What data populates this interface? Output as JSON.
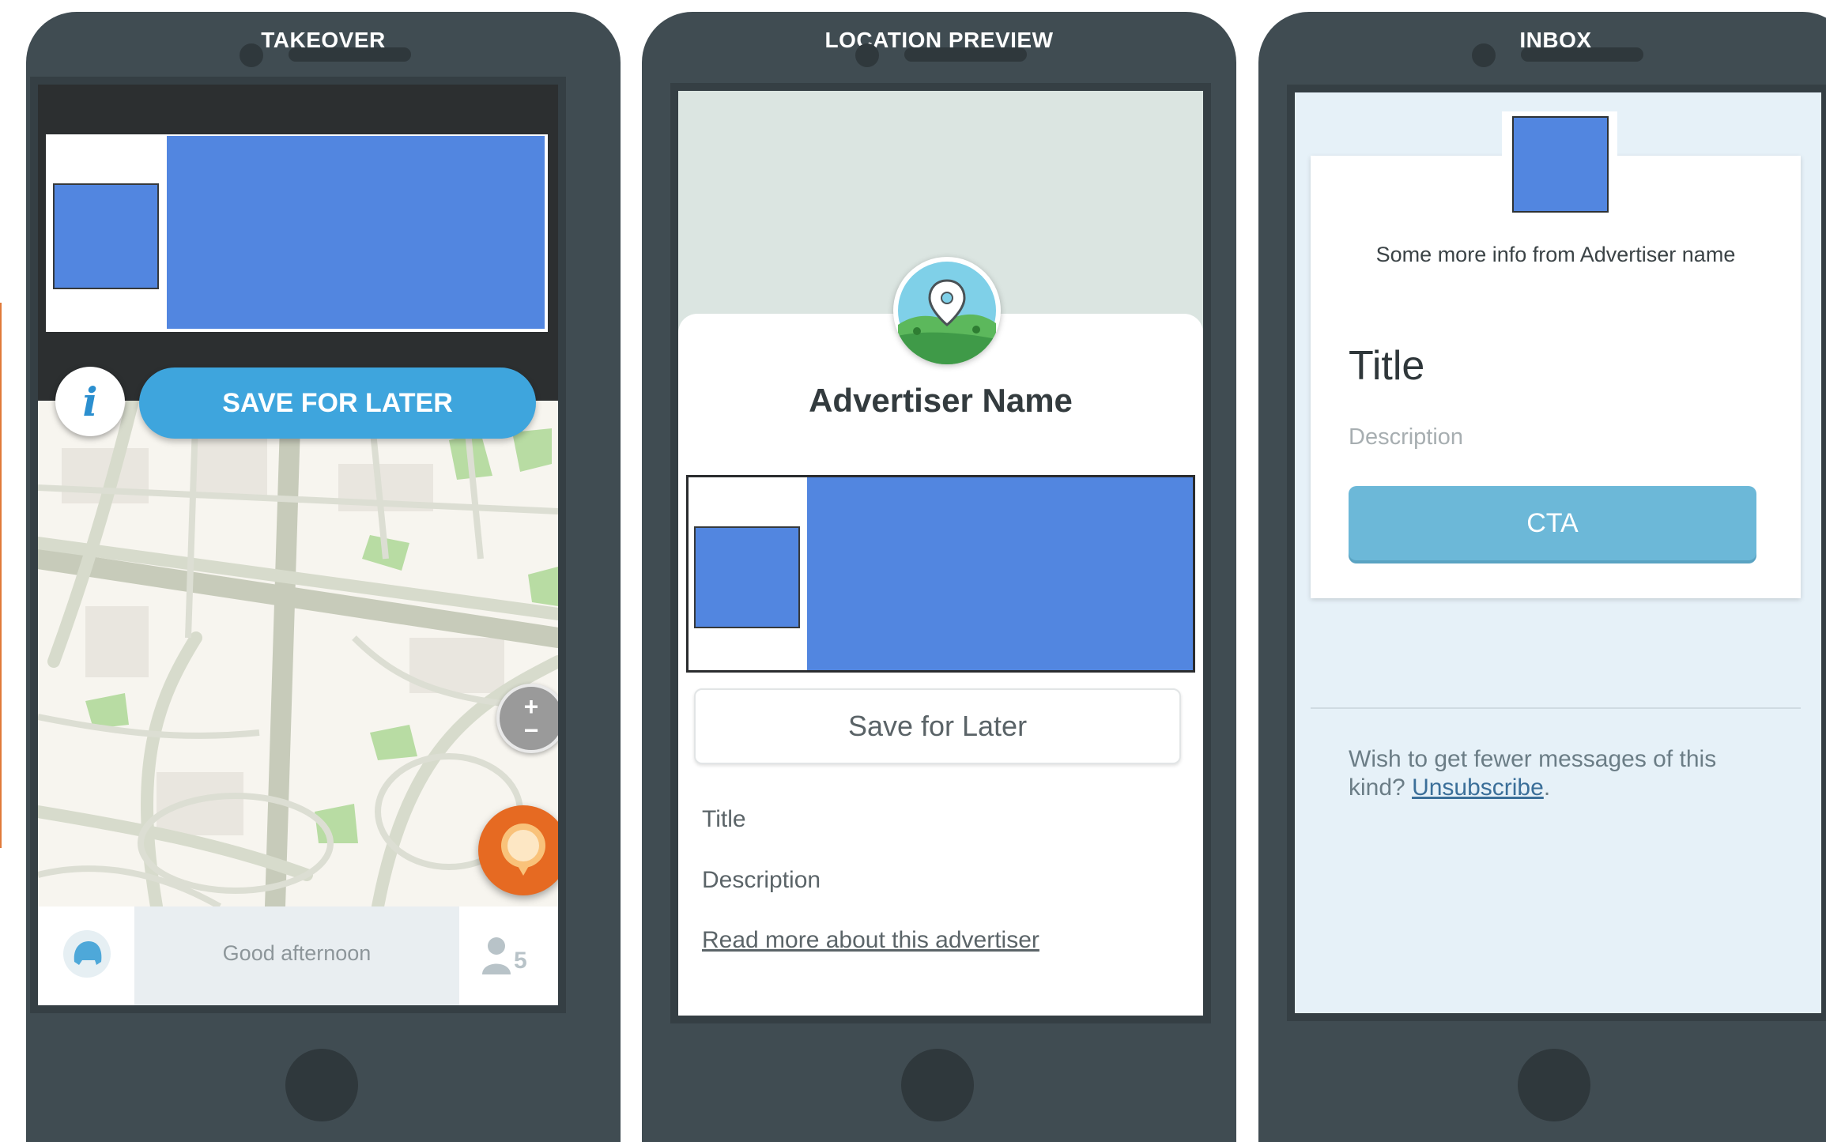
{
  "phones": [
    {
      "title": "TAKEOVER",
      "info_icon": "i",
      "save_button": "SAVE FOR LATER",
      "zoom_in": "+",
      "zoom_out": "−",
      "greeting": "Good afternoon",
      "friends_count": "5"
    },
    {
      "title": "LOCATION PREVIEW",
      "advertiser_name": "Advertiser Name",
      "save_button": "Save for Later",
      "field_title": "Title",
      "field_description": "Description",
      "read_more": "Read more about this advertiser"
    },
    {
      "title": "INBOX",
      "info_text": "Some more info from Advertiser name",
      "message_title": "Title",
      "message_description": "Description",
      "cta": "CTA",
      "unsubscribe_prefix": "Wish to get fewer messages of this kind? ",
      "unsubscribe_link": "Unsubscribe",
      "unsubscribe_suffix": "."
    }
  ],
  "colors": {
    "phone_body": "#404c52",
    "placeholder_blue": "#5286e0",
    "primary_button": "#3ea5dd",
    "cta_button": "#6cb8d8",
    "report_orange": "#e66a22"
  },
  "icons": [
    "info-icon",
    "zoom-icon",
    "report-pin-icon",
    "menu-icon",
    "friends-icon",
    "location-pin-icon"
  ]
}
